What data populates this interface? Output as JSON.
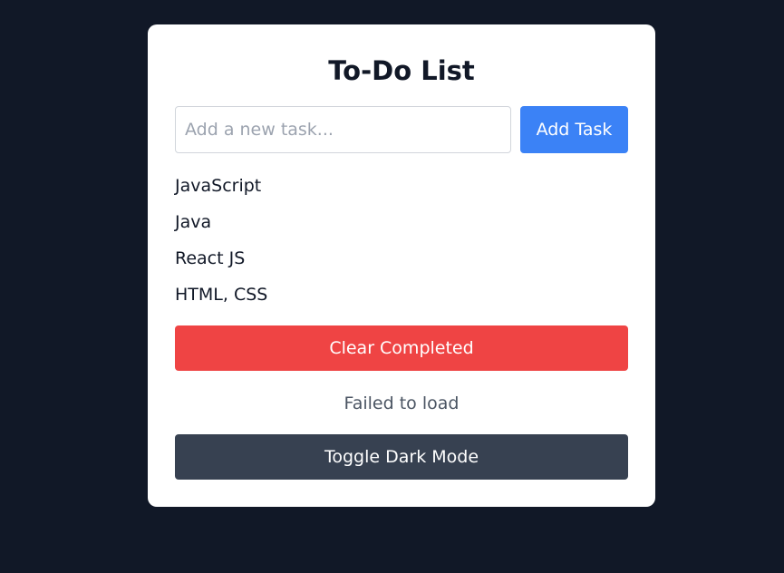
{
  "app": {
    "title": "To-Do List"
  },
  "input": {
    "value": "",
    "placeholder": "Add a new task..."
  },
  "buttons": {
    "add_label": "Add Task",
    "clear_label": "Clear Completed",
    "toggle_label": "Toggle Dark Mode"
  },
  "tasks": [
    {
      "label": "JavaScript"
    },
    {
      "label": "Java"
    },
    {
      "label": "React JS"
    },
    {
      "label": "HTML, CSS"
    }
  ],
  "status": {
    "message": "Failed to load"
  },
  "colors": {
    "background": "#111827",
    "card": "#ffffff",
    "primary": "#3b82f6",
    "danger": "#ef4444",
    "dark_button": "#374151",
    "text": "#111827",
    "muted_text": "#4b5563"
  }
}
